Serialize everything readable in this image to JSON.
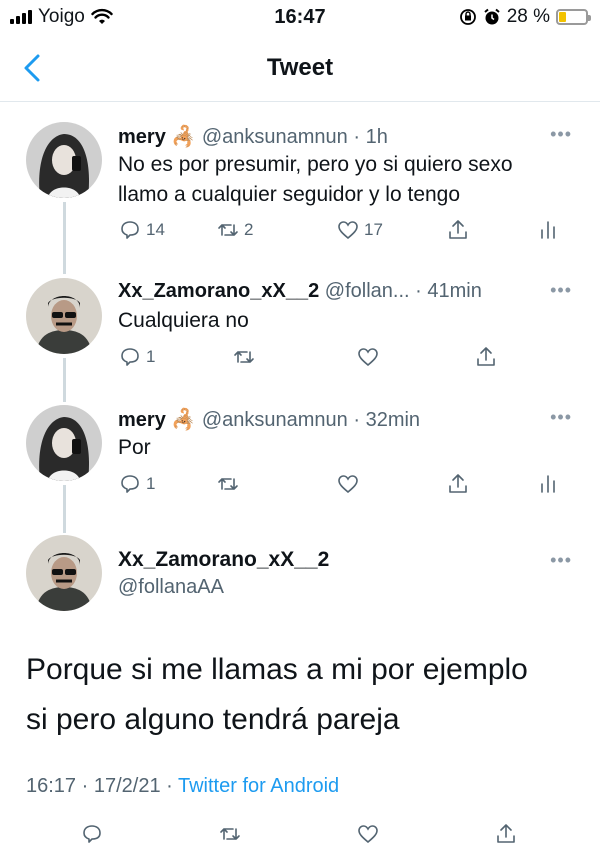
{
  "status_bar": {
    "carrier": "Yoigo",
    "time": "16:47",
    "battery_percent": "28 %",
    "battery_level": 0.28,
    "battery_color": "#f2c200"
  },
  "nav": {
    "back_icon": "chevron-left-icon",
    "title": "Tweet"
  },
  "thread": [
    {
      "name": "mery",
      "handle": "@anksunamnun",
      "time": "1h",
      "text_lines": [
        "No es por presumir, pero yo si quiero sexo",
        "llamo a cualquier seguidor y lo tengo"
      ],
      "replies": "14",
      "retweets": "2",
      "likes": "17",
      "show_analytics": true
    },
    {
      "name": "Xx_Zamorano_xX__2",
      "handle": "@follan...",
      "time": "41min",
      "text_lines": [
        "Cualquiera no"
      ],
      "replies": "1",
      "retweets": "",
      "likes": "",
      "show_analytics": false
    },
    {
      "name": "mery",
      "handle": "@anksunamnun",
      "time": "32min",
      "text_lines": [
        "Por"
      ],
      "replies": "1",
      "retweets": "",
      "likes": "",
      "show_analytics": true
    }
  ],
  "main_tweet": {
    "name": "Xx_Zamorano_xX__2",
    "handle": "@follanaAA",
    "text_lines": [
      "Porque si me llamas a mi por ejemplo",
      "si pero alguno tendrá pareja"
    ],
    "time": "16:17",
    "date": "17/2/21",
    "source": "Twitter for Android"
  },
  "colors": {
    "accent": "#1d9bf0",
    "secondary_text": "#536471",
    "nav_blue": "#1d9bf0"
  }
}
